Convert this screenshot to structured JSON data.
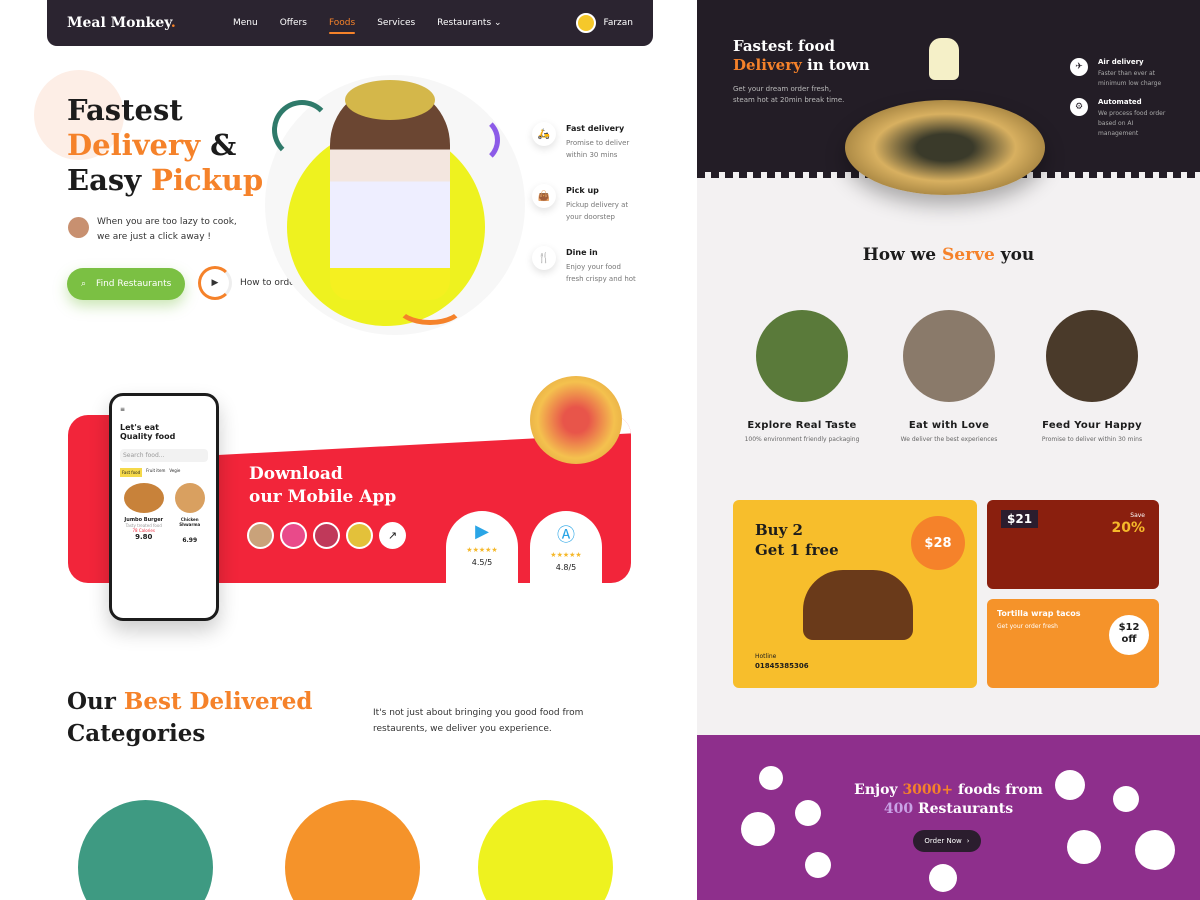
{
  "brand": {
    "name": "Meal Monkey",
    "dot": "."
  },
  "nav": {
    "items": [
      "Menu",
      "Offers",
      "Foods",
      "Services",
      "Restaurants"
    ],
    "active": "Foods",
    "user": "Farzan"
  },
  "hero": {
    "line1": "Fastest",
    "line2a": "Delivery",
    "line2b": " &",
    "line3a": "Easy ",
    "line3b": "Pickup",
    "tagline1": "When you are too lazy to cook,",
    "tagline2": "we are just a click away !",
    "find_btn": "Find Restaurants",
    "how": "How to order"
  },
  "features": [
    {
      "title": "Fast delivery",
      "desc": "Promise to deliver within 30 mins",
      "icon": "scooter-icon"
    },
    {
      "title": "Pick up",
      "desc": "Pickup delivery at your doorstep",
      "icon": "bag-icon"
    },
    {
      "title": "Dine in",
      "desc": "Enjoy your food fresh crispy and hot",
      "icon": "cutlery-icon"
    }
  ],
  "app": {
    "line1": "Download",
    "line2": "our Mobile App",
    "stores": [
      {
        "icon": "play-store-icon",
        "rating": "4.5/5"
      },
      {
        "icon": "app-store-icon",
        "rating": "4.8/5"
      }
    ],
    "phone": {
      "title1": "Let's eat",
      "title2": "Quality food",
      "search": "Search food...",
      "chips": [
        "Fast food",
        "Fruit item",
        "Vegie"
      ],
      "item1": "Jumbo Burger",
      "item1_sub": "Tasty treated food",
      "item1_cal": "78 Calories",
      "item1_price": "9.80",
      "item2": "Chicken Shwarma",
      "item2_price": "6.99"
    }
  },
  "categories": {
    "t1": "Our ",
    "t2": "Best Delivered",
    "t3": "Categories",
    "text1": "It's not just about bringing you good food from",
    "text2": "restaurents, we deliver you experience."
  },
  "right": {
    "top": {
      "l1": "Fastest food",
      "l2a": "Delivery",
      "l2b": " in town",
      "desc": "Get your dream order fresh, steam hot at 20min break time."
    },
    "rfeatures": [
      {
        "title": "Air delivery",
        "desc": "Faster than ever at minimum low charge",
        "icon": "plane-icon"
      },
      {
        "title": "Automated",
        "desc": "We process food order based on AI management",
        "icon": "robot-icon"
      }
    ],
    "serve": {
      "t1": "How we ",
      "t2": "Serve",
      "t3": " you",
      "items": [
        {
          "name": "Explore Real Taste",
          "desc": "100% environment friendly packaging"
        },
        {
          "name": "Eat with Love",
          "desc": "We deliver the best experiences"
        },
        {
          "name": "Feed Your Happy",
          "desc": "Promise to deliver within 30 mins"
        }
      ]
    },
    "promo": {
      "buy": "Buy 2",
      "get": "Get 1 free",
      "price": "$28",
      "hotline": "Hotline",
      "phone": "01845385306",
      "p2price": "$21",
      "p2save": "Save",
      "p2pct": "20%",
      "p3title": "Tortilla wrap tacos",
      "p3sub": "Get your order fresh",
      "p3price": "$12",
      "p3off": "off"
    },
    "enjoy": {
      "a": "Enjoy ",
      "b": "3000+",
      "c": " foods from",
      "d": "400",
      "e": " Restaurants",
      "btn": "Order Now"
    }
  },
  "colors": {
    "accent": "#f5822a",
    "green": "#7bc043",
    "red": "#f2253a",
    "dark": "#231d26",
    "purple": "#8e2f8c"
  }
}
